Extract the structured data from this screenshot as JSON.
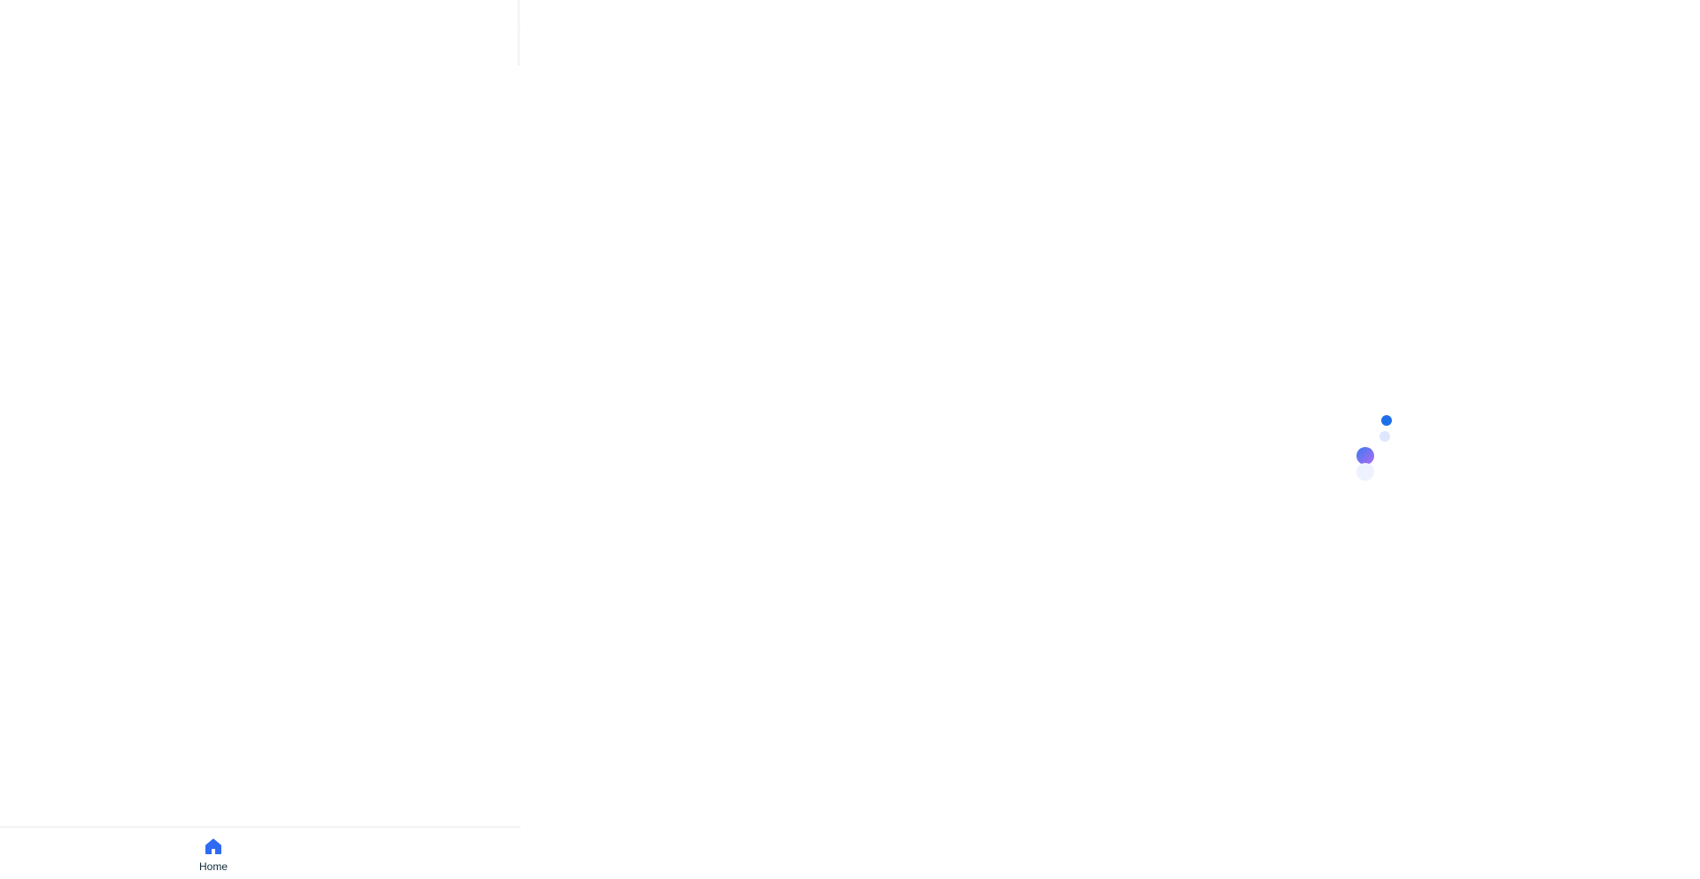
{
  "bottom_nav": {
    "items": [
      {
        "label": "Home",
        "icon": "home-icon",
        "active": true
      }
    ]
  },
  "loading": {
    "state": "loading",
    "colors": {
      "dot_primary": "#1f6fe8",
      "dot_large_gradient_start": "#3c7bf3",
      "dot_large_gradient_end": "#b06bf0",
      "dot_faint": "#dfe7ff"
    }
  },
  "theme": {
    "accent": "#2f6bf2",
    "text": "#0c2a3a",
    "border": "#ececec",
    "background": "#ffffff"
  }
}
